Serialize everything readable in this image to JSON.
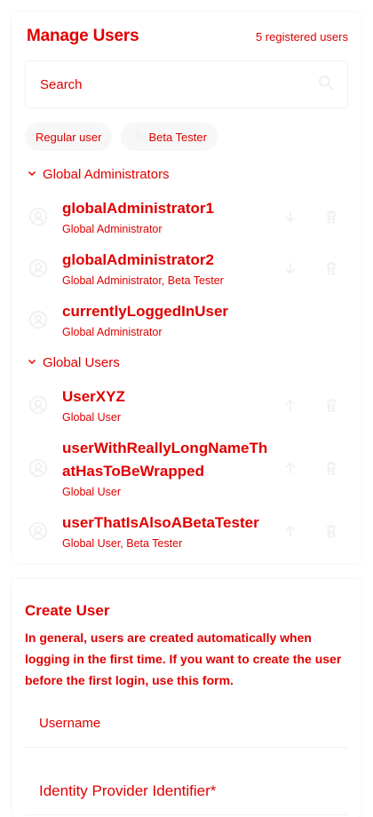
{
  "header": {
    "title": "Manage Users",
    "count": "5 registered users"
  },
  "search": {
    "placeholder": "Search"
  },
  "filters": [
    {
      "label": "Regular user"
    },
    {
      "label": "Beta Tester",
      "icon": "person-icon"
    }
  ],
  "groups": [
    {
      "title": "Global Administrators",
      "icon": "chevron-down-icon"
    },
    {
      "title": "Global Users",
      "icon": "chevron-down-icon"
    }
  ],
  "users": [
    {
      "name": "globalAdministrator1",
      "role": "Global Administrator",
      "action": "demote"
    },
    {
      "name": "globalAdministrator2",
      "role": "Global Administrator, Beta Tester",
      "action": "demote"
    },
    {
      "name": "currentlyLoggedInUser",
      "role": "Global Administrator"
    },
    {
      "name": "UserXYZ",
      "role": "Global User",
      "action": "promote"
    },
    {
      "name": "userWithReallyLongNameThatHasToBeWrapped",
      "name_line1": "userWithReallyLongNameTh",
      "name_line2": "atHasToBeWrapped",
      "role": "Global User",
      "action": "promote"
    },
    {
      "name": "userThatIsAlsoABetaTester",
      "role": "Global User, Beta Tester",
      "action": "promote"
    }
  ],
  "create": {
    "title": "Create User",
    "description": "In general, users are created automatically when logging in the first time. If you want to create the user before the first login, use this form.",
    "username_placeholder": "Username",
    "identifier_placeholder": "Identity Provider Identifier*"
  },
  "colors": {
    "text": "#e00000",
    "icon": "#f0f0f0",
    "divider": "#f1f1f1"
  }
}
